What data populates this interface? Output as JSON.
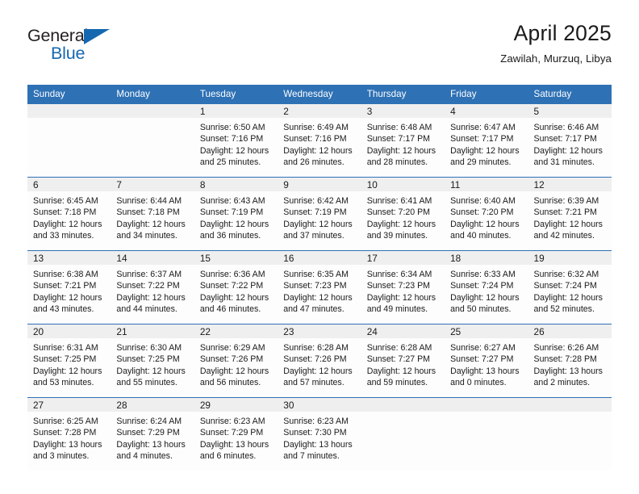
{
  "logo": {
    "word_one": "General",
    "word_two": "Blue",
    "triangle_color": "#1568b0"
  },
  "header": {
    "title": "April 2025",
    "location": "Zawilah, Murzuq, Libya"
  },
  "theme": {
    "header_blue": "#2e71b5",
    "daynum_band": "#efefef",
    "cell_background": "#fdfdfd",
    "row_divider": "#2e71b5"
  },
  "weekday_headers": [
    "Sunday",
    "Monday",
    "Tuesday",
    "Wednesday",
    "Thursday",
    "Friday",
    "Saturday"
  ],
  "weeks": [
    [
      {
        "day": ""
      },
      {
        "day": ""
      },
      {
        "day": "1",
        "sunrise": "Sunrise: 6:50 AM",
        "sunset": "Sunset: 7:16 PM",
        "daylight_1": "Daylight: 12 hours",
        "daylight_2": "and 25 minutes."
      },
      {
        "day": "2",
        "sunrise": "Sunrise: 6:49 AM",
        "sunset": "Sunset: 7:16 PM",
        "daylight_1": "Daylight: 12 hours",
        "daylight_2": "and 26 minutes."
      },
      {
        "day": "3",
        "sunrise": "Sunrise: 6:48 AM",
        "sunset": "Sunset: 7:17 PM",
        "daylight_1": "Daylight: 12 hours",
        "daylight_2": "and 28 minutes."
      },
      {
        "day": "4",
        "sunrise": "Sunrise: 6:47 AM",
        "sunset": "Sunset: 7:17 PM",
        "daylight_1": "Daylight: 12 hours",
        "daylight_2": "and 29 minutes."
      },
      {
        "day": "5",
        "sunrise": "Sunrise: 6:46 AM",
        "sunset": "Sunset: 7:17 PM",
        "daylight_1": "Daylight: 12 hours",
        "daylight_2": "and 31 minutes."
      }
    ],
    [
      {
        "day": "6",
        "sunrise": "Sunrise: 6:45 AM",
        "sunset": "Sunset: 7:18 PM",
        "daylight_1": "Daylight: 12 hours",
        "daylight_2": "and 33 minutes."
      },
      {
        "day": "7",
        "sunrise": "Sunrise: 6:44 AM",
        "sunset": "Sunset: 7:18 PM",
        "daylight_1": "Daylight: 12 hours",
        "daylight_2": "and 34 minutes."
      },
      {
        "day": "8",
        "sunrise": "Sunrise: 6:43 AM",
        "sunset": "Sunset: 7:19 PM",
        "daylight_1": "Daylight: 12 hours",
        "daylight_2": "and 36 minutes."
      },
      {
        "day": "9",
        "sunrise": "Sunrise: 6:42 AM",
        "sunset": "Sunset: 7:19 PM",
        "daylight_1": "Daylight: 12 hours",
        "daylight_2": "and 37 minutes."
      },
      {
        "day": "10",
        "sunrise": "Sunrise: 6:41 AM",
        "sunset": "Sunset: 7:20 PM",
        "daylight_1": "Daylight: 12 hours",
        "daylight_2": "and 39 minutes."
      },
      {
        "day": "11",
        "sunrise": "Sunrise: 6:40 AM",
        "sunset": "Sunset: 7:20 PM",
        "daylight_1": "Daylight: 12 hours",
        "daylight_2": "and 40 minutes."
      },
      {
        "day": "12",
        "sunrise": "Sunrise: 6:39 AM",
        "sunset": "Sunset: 7:21 PM",
        "daylight_1": "Daylight: 12 hours",
        "daylight_2": "and 42 minutes."
      }
    ],
    [
      {
        "day": "13",
        "sunrise": "Sunrise: 6:38 AM",
        "sunset": "Sunset: 7:21 PM",
        "daylight_1": "Daylight: 12 hours",
        "daylight_2": "and 43 minutes."
      },
      {
        "day": "14",
        "sunrise": "Sunrise: 6:37 AM",
        "sunset": "Sunset: 7:22 PM",
        "daylight_1": "Daylight: 12 hours",
        "daylight_2": "and 44 minutes."
      },
      {
        "day": "15",
        "sunrise": "Sunrise: 6:36 AM",
        "sunset": "Sunset: 7:22 PM",
        "daylight_1": "Daylight: 12 hours",
        "daylight_2": "and 46 minutes."
      },
      {
        "day": "16",
        "sunrise": "Sunrise: 6:35 AM",
        "sunset": "Sunset: 7:23 PM",
        "daylight_1": "Daylight: 12 hours",
        "daylight_2": "and 47 minutes."
      },
      {
        "day": "17",
        "sunrise": "Sunrise: 6:34 AM",
        "sunset": "Sunset: 7:23 PM",
        "daylight_1": "Daylight: 12 hours",
        "daylight_2": "and 49 minutes."
      },
      {
        "day": "18",
        "sunrise": "Sunrise: 6:33 AM",
        "sunset": "Sunset: 7:24 PM",
        "daylight_1": "Daylight: 12 hours",
        "daylight_2": "and 50 minutes."
      },
      {
        "day": "19",
        "sunrise": "Sunrise: 6:32 AM",
        "sunset": "Sunset: 7:24 PM",
        "daylight_1": "Daylight: 12 hours",
        "daylight_2": "and 52 minutes."
      }
    ],
    [
      {
        "day": "20",
        "sunrise": "Sunrise: 6:31 AM",
        "sunset": "Sunset: 7:25 PM",
        "daylight_1": "Daylight: 12 hours",
        "daylight_2": "and 53 minutes."
      },
      {
        "day": "21",
        "sunrise": "Sunrise: 6:30 AM",
        "sunset": "Sunset: 7:25 PM",
        "daylight_1": "Daylight: 12 hours",
        "daylight_2": "and 55 minutes."
      },
      {
        "day": "22",
        "sunrise": "Sunrise: 6:29 AM",
        "sunset": "Sunset: 7:26 PM",
        "daylight_1": "Daylight: 12 hours",
        "daylight_2": "and 56 minutes."
      },
      {
        "day": "23",
        "sunrise": "Sunrise: 6:28 AM",
        "sunset": "Sunset: 7:26 PM",
        "daylight_1": "Daylight: 12 hours",
        "daylight_2": "and 57 minutes."
      },
      {
        "day": "24",
        "sunrise": "Sunrise: 6:28 AM",
        "sunset": "Sunset: 7:27 PM",
        "daylight_1": "Daylight: 12 hours",
        "daylight_2": "and 59 minutes."
      },
      {
        "day": "25",
        "sunrise": "Sunrise: 6:27 AM",
        "sunset": "Sunset: 7:27 PM",
        "daylight_1": "Daylight: 13 hours",
        "daylight_2": "and 0 minutes."
      },
      {
        "day": "26",
        "sunrise": "Sunrise: 6:26 AM",
        "sunset": "Sunset: 7:28 PM",
        "daylight_1": "Daylight: 13 hours",
        "daylight_2": "and 2 minutes."
      }
    ],
    [
      {
        "day": "27",
        "sunrise": "Sunrise: 6:25 AM",
        "sunset": "Sunset: 7:28 PM",
        "daylight_1": "Daylight: 13 hours",
        "daylight_2": "and 3 minutes."
      },
      {
        "day": "28",
        "sunrise": "Sunrise: 6:24 AM",
        "sunset": "Sunset: 7:29 PM",
        "daylight_1": "Daylight: 13 hours",
        "daylight_2": "and 4 minutes."
      },
      {
        "day": "29",
        "sunrise": "Sunrise: 6:23 AM",
        "sunset": "Sunset: 7:29 PM",
        "daylight_1": "Daylight: 13 hours",
        "daylight_2": "and 6 minutes."
      },
      {
        "day": "30",
        "sunrise": "Sunrise: 6:23 AM",
        "sunset": "Sunset: 7:30 PM",
        "daylight_1": "Daylight: 13 hours",
        "daylight_2": "and 7 minutes."
      },
      {
        "day": ""
      },
      {
        "day": ""
      },
      {
        "day": ""
      }
    ]
  ]
}
